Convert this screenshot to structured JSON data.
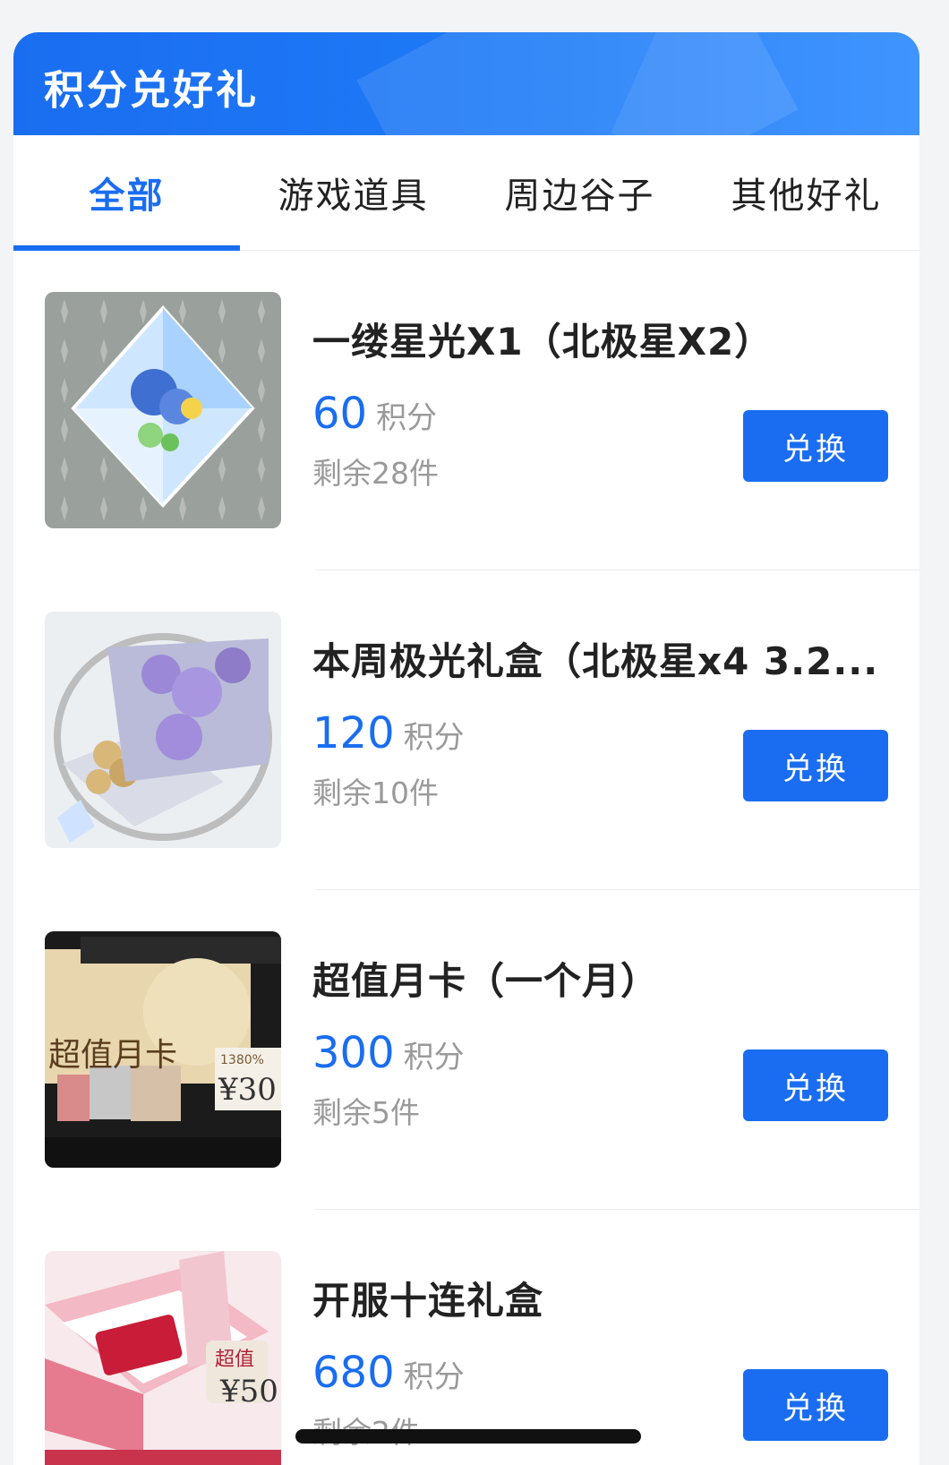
{
  "header": {
    "title": "积分兑好礼"
  },
  "tabs": [
    {
      "label": "全部",
      "active": true
    },
    {
      "label": "游戏道具",
      "active": false
    },
    {
      "label": "周边谷子",
      "active": false
    },
    {
      "label": "其他好礼",
      "active": false
    }
  ],
  "items": [
    {
      "name": "一缕星光X1（北极星X2）",
      "price": "60",
      "unit": "积分",
      "stock": "剩余28件",
      "button": "兑换",
      "thumb_icon": "crystal-diamond-icon"
    },
    {
      "name": "本周极光礼盒（北极星x4 3.2...",
      "price": "120",
      "unit": "积分",
      "stock": "剩余10件",
      "button": "兑换",
      "thumb_icon": "gift-box-icon"
    },
    {
      "name": "超值月卡（一个月）",
      "price": "300",
      "unit": "积分",
      "stock": "剩余5件",
      "button": "兑换",
      "thumb_icon": "monthly-card-icon",
      "thumb_text": {
        "title": "超值月卡",
        "badge": "1380%",
        "price": "¥30"
      }
    },
    {
      "name": "开服十连礼盒",
      "price": "680",
      "unit": "积分",
      "stock": "剩余2件",
      "button": "兑换",
      "thumb_icon": "ten-pull-box-icon",
      "thumb_text": {
        "tag": "超值",
        "price": "¥50"
      }
    }
  ],
  "colors": {
    "accent": "#1a6df0",
    "muted": "#9a9a9a",
    "text": "#222222"
  }
}
